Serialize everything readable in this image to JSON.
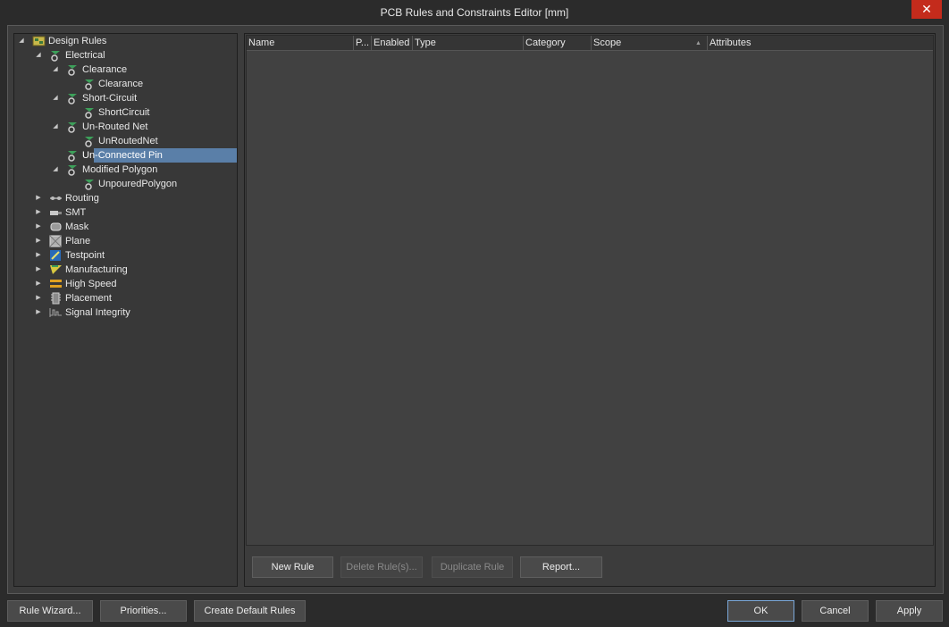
{
  "window": {
    "title": "PCB Rules and Constraints Editor [mm]",
    "close_glyph": "✕"
  },
  "tree": {
    "items": [
      {
        "label": "Design Rules",
        "expanded": true,
        "icon": "design-rules-icon"
      },
      {
        "label": "Electrical",
        "expanded": true,
        "icon": "electrical-icon"
      },
      {
        "label": "Clearance",
        "expanded": true,
        "icon": "electrical-icon"
      },
      {
        "label": "Clearance",
        "icon": "rule-icon"
      },
      {
        "label": "Short-Circuit",
        "expanded": true,
        "icon": "electrical-icon"
      },
      {
        "label": "ShortCircuit",
        "icon": "rule-icon"
      },
      {
        "label": "Un-Routed Net",
        "expanded": true,
        "icon": "electrical-icon"
      },
      {
        "label": "UnRoutedNet",
        "icon": "rule-icon"
      },
      {
        "label": "Un-Connected Pin",
        "selected": true,
        "icon": "electrical-icon"
      },
      {
        "label": "Modified Polygon",
        "expanded": true,
        "icon": "electrical-icon"
      },
      {
        "label": "UnpouredPolygon",
        "icon": "rule-icon"
      },
      {
        "label": "Routing",
        "expanded": false,
        "icon": "routing-icon"
      },
      {
        "label": "SMT",
        "expanded": false,
        "icon": "smt-icon"
      },
      {
        "label": "Mask",
        "expanded": false,
        "icon": "mask-icon"
      },
      {
        "label": "Plane",
        "expanded": false,
        "icon": "plane-icon"
      },
      {
        "label": "Testpoint",
        "expanded": false,
        "icon": "testpoint-icon"
      },
      {
        "label": "Manufacturing",
        "expanded": false,
        "icon": "manufacturing-icon"
      },
      {
        "label": "High Speed",
        "expanded": false,
        "icon": "high-speed-icon"
      },
      {
        "label": "Placement",
        "expanded": false,
        "icon": "placement-icon"
      },
      {
        "label": "Signal Integrity",
        "expanded": false,
        "icon": "signal-integrity-icon"
      }
    ]
  },
  "grid": {
    "columns": [
      "Name",
      "P...",
      "Enabled",
      "Type",
      "Category",
      "Scope",
      "Attributes"
    ],
    "rows": []
  },
  "grid_buttons": {
    "new_rule": "New Rule",
    "delete_rule": "Delete Rule(s)...",
    "duplicate_rule": "Duplicate Rule",
    "report": "Report..."
  },
  "footer": {
    "rule_wizard": "Rule Wizard...",
    "priorities": "Priorities...",
    "create_default_rules": "Create Default Rules",
    "ok": "OK",
    "cancel": "Cancel",
    "apply": "Apply"
  }
}
